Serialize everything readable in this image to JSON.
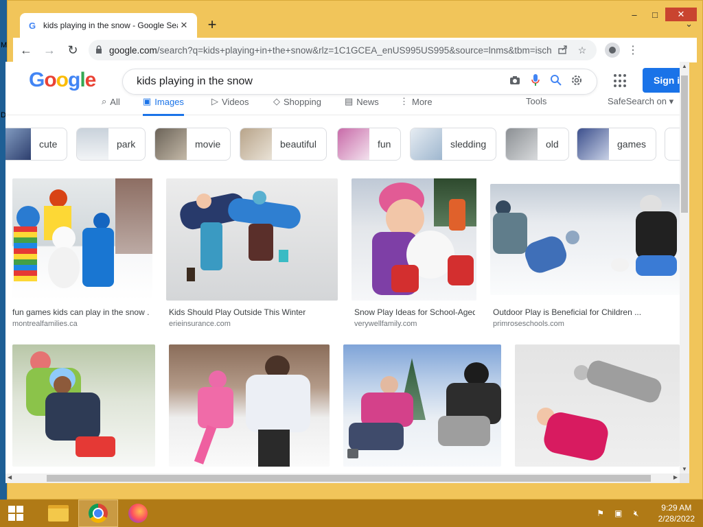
{
  "desktop": {
    "edge_labels": [
      "M",
      "D"
    ]
  },
  "window": {
    "controls": {
      "minimize": "–",
      "maximize": "□",
      "close": "✕"
    }
  },
  "tab": {
    "favicon": "G",
    "title": "kids playing in the snow - Google Search",
    "close": "✕",
    "new_tab": "+",
    "tab_menu": "⌄"
  },
  "toolbar": {
    "back": "←",
    "forward": "→",
    "reload": "↻",
    "url_host": "google.com",
    "url_path": "/search?q=kids+playing+in+the+snow&rlz=1C1GCEA_enUS995US995&source=lnms&tbm=isch&s...",
    "share_icon": "share-icon",
    "bookmark": "☆",
    "menu": "⋮"
  },
  "google": {
    "logo": [
      "G",
      "o",
      "o",
      "g",
      "l",
      "e"
    ],
    "query": "kids playing in the snow",
    "signin": "Sign in",
    "tabs": [
      {
        "label": "All",
        "icon": "⌕"
      },
      {
        "label": "Images",
        "icon": "▣"
      },
      {
        "label": "Videos",
        "icon": "▷"
      },
      {
        "label": "Shopping",
        "icon": "◇"
      },
      {
        "label": "News",
        "icon": "▤"
      },
      {
        "label": "More",
        "icon": "⋮"
      }
    ],
    "tools": "Tools",
    "safesearch": "SafeSearch on ▾"
  },
  "chips": [
    {
      "label": "cute",
      "color": "#8aa4c8"
    },
    {
      "label": "park",
      "color": "#d9dde3"
    },
    {
      "label": "movie",
      "color": "#6b6358"
    },
    {
      "label": "beautiful",
      "color": "#b8a48a"
    },
    {
      "label": "fun",
      "color": "#c86aa8"
    },
    {
      "label": "sledding",
      "color": "#e6ecf2"
    },
    {
      "label": "old",
      "color": "#8b8f93"
    },
    {
      "label": "games",
      "color": "#3c4f8c"
    }
  ],
  "results_row1": [
    {
      "title": "fun games kids can play in the snow ...",
      "source": "montrealfamilies.ca"
    },
    {
      "title": "Kids Should Play Outside This Winter",
      "source": "erieinsurance.com"
    },
    {
      "title": "Snow Play Ideas for School-Aged Kids",
      "source": "verywellfamily.com"
    },
    {
      "title": "Outdoor Play is Beneficial for Children ...",
      "source": "primroseschools.com"
    }
  ],
  "taskbar": {
    "time": "9:29 AM",
    "date": "2/28/2022"
  }
}
